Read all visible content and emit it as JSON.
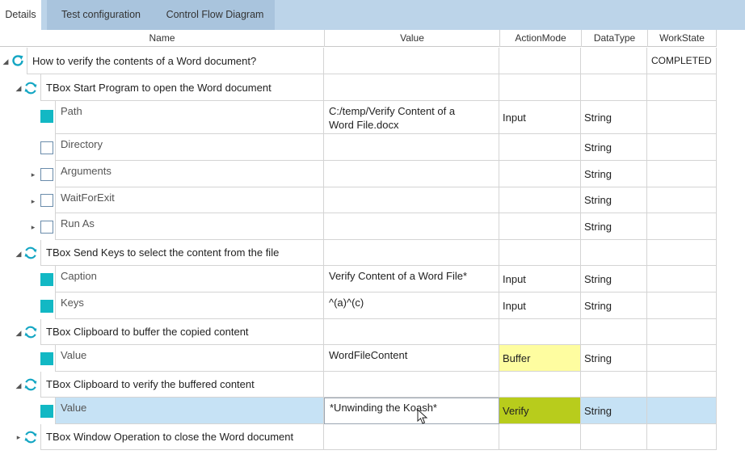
{
  "tabs": [
    {
      "label": "Details"
    },
    {
      "label": "Test configuration"
    },
    {
      "label": "Control Flow Diagram"
    }
  ],
  "columns": {
    "name": "Name",
    "value": "Value",
    "action_mode": "ActionMode",
    "data_type": "DataType",
    "work_state": "WorkState"
  },
  "colors": {
    "buffer": "#fefda0",
    "verify": "#b8cc1c",
    "checkbox_filled": "#12b8c4",
    "selected_row": "#c6e2f5",
    "tab_bar": "#bcd4e9"
  },
  "rows": {
    "root": {
      "name": "How to verify the contents of a Word document?",
      "work_state": "COMPLETED",
      "icon": "refresh-icon",
      "expander": "collapse"
    },
    "g1": {
      "name": "TBox Start Program to open the Word document",
      "icon": "refresh-icon",
      "expander": "collapse"
    },
    "path": {
      "name": "Path",
      "value_line1": "C:/temp/Verify Content of a",
      "value_line2": "Word File.docx",
      "action_mode": "Input",
      "data_type": "String",
      "checked": true
    },
    "directory": {
      "name": "Directory",
      "data_type": "String",
      "checked": false
    },
    "arguments": {
      "name": "Arguments",
      "data_type": "String",
      "checked": false,
      "expander": "expand"
    },
    "waitforexit": {
      "name": "WaitForExit",
      "data_type": "String",
      "checked": false,
      "expander": "expand"
    },
    "runas": {
      "name": "Run As",
      "data_type": "String",
      "checked": false,
      "expander": "expand"
    },
    "g2": {
      "name": "TBox Send Keys to select the content from the file",
      "icon": "refresh-icon",
      "expander": "collapse"
    },
    "caption": {
      "name": "Caption",
      "value": "Verify Content of a Word File*",
      "action_mode": "Input",
      "data_type": "String",
      "checked": true
    },
    "keys": {
      "name": "Keys",
      "value": "^(a)^(c)",
      "action_mode": "Input",
      "data_type": "String",
      "checked": true
    },
    "g3": {
      "name": "TBox Clipboard to buffer the copied content",
      "icon": "refresh-icon",
      "expander": "collapse"
    },
    "value1": {
      "name": "Value",
      "value": "WordFileContent",
      "action_mode": "Buffer",
      "data_type": "String",
      "checked": true
    },
    "g4": {
      "name": "TBox Clipboard to verify the buffered content",
      "icon": "refresh-icon",
      "expander": "collapse"
    },
    "value2": {
      "name": "Value",
      "value": "*Unwinding the Koash*",
      "action_mode": "Verify",
      "data_type": "String",
      "checked": true,
      "selected": true
    },
    "g5": {
      "name": "TBox Window Operation to close the Word document",
      "icon": "refresh-icon",
      "expander": "expand"
    }
  }
}
